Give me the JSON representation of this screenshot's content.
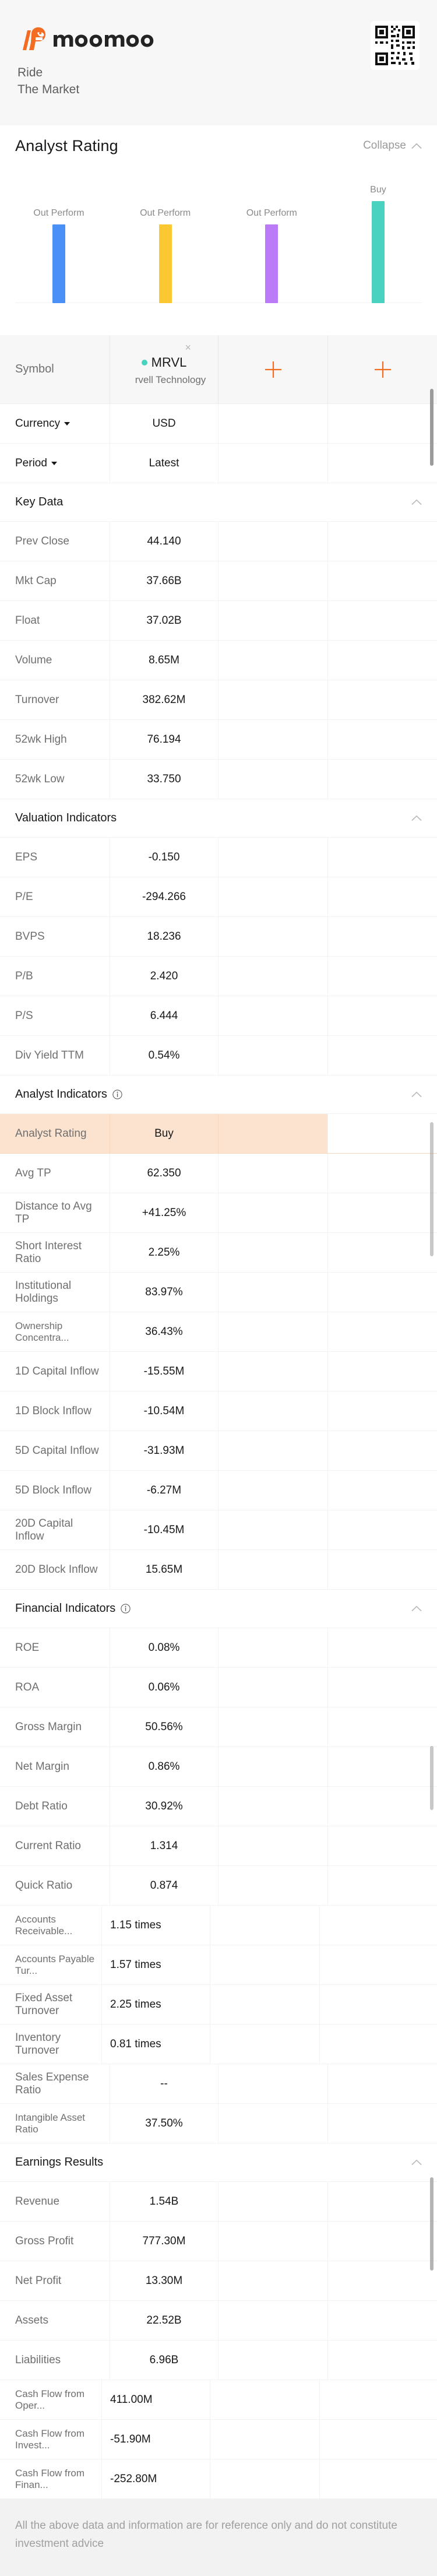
{
  "brand": {
    "name": "moomoo",
    "tagline_line1": "Ride",
    "tagline_line2": "The Market",
    "qr_alt": "qr-code"
  },
  "section": {
    "title": "Analyst Rating",
    "collapse_label": "Collapse"
  },
  "chart_data": {
    "type": "bar",
    "title": "Analyst Rating",
    "categories": [
      "Out Perform",
      "Out Perform",
      "Out Perform",
      "Buy"
    ],
    "values": [
      60,
      60,
      60,
      78
    ],
    "colors": [
      "#4a90f7",
      "#fbc833",
      "#bb7bf7",
      "#4ad2c0"
    ],
    "labels": [
      "Out Perform",
      "Out Perform",
      "Out Perform",
      "Buy"
    ],
    "xlabel": "",
    "ylabel": "",
    "ylim": [
      0,
      100
    ],
    "grid": false,
    "legend": "none"
  },
  "table": {
    "symbol_header_label": "Symbol",
    "columns": [
      {
        "ticker": "MRVL",
        "company": "rvell Technology",
        "dot_color": "#4ad2c0",
        "close_label": "×"
      },
      {
        "add_label": "+"
      },
      {
        "add_label": "+"
      }
    ],
    "controls": [
      {
        "label": "Currency",
        "value": "USD",
        "caret": true
      },
      {
        "label": "Period",
        "value": "Latest",
        "caret": true
      }
    ],
    "groups": [
      {
        "title": "Key Data",
        "info": false,
        "collapse_icon": "chevron-up-icon",
        "rows": [
          {
            "label": "Prev Close",
            "value": "44.140"
          },
          {
            "label": "Mkt Cap",
            "value": "37.66B"
          },
          {
            "label": "Float",
            "value": "37.02B"
          },
          {
            "label": "Volume",
            "value": "8.65M"
          },
          {
            "label": "Turnover",
            "value": "382.62M"
          },
          {
            "label": "52wk High",
            "value": "76.194"
          },
          {
            "label": "52wk Low",
            "value": "33.750"
          }
        ]
      },
      {
        "title": "Valuation Indicators",
        "info": false,
        "collapse_icon": "chevron-up-icon",
        "rows": [
          {
            "label": "EPS",
            "value": "-0.150"
          },
          {
            "label": "P/E",
            "value": "-294.266"
          },
          {
            "label": "BVPS",
            "value": "18.236"
          },
          {
            "label": "P/B",
            "value": "2.420"
          },
          {
            "label": "P/S",
            "value": "6.444"
          },
          {
            "label": "Div Yield TTM",
            "value": "0.54%"
          }
        ]
      },
      {
        "title": "Analyst Indicators",
        "info": true,
        "collapse_icon": "chevron-up-icon",
        "rows": [
          {
            "label": "Analyst Rating",
            "value": "Buy",
            "highlight": true
          },
          {
            "label": "Avg TP",
            "value": "62.350"
          },
          {
            "label": "Distance to Avg TP",
            "value": "+41.25%"
          },
          {
            "label": "Short Interest Ratio",
            "value": "2.25%"
          },
          {
            "label": "Institutional Holdings",
            "value": "83.97%"
          },
          {
            "label": "Ownership Concentra...",
            "value": "36.43%",
            "small": true
          },
          {
            "label": "1D Capital Inflow",
            "value": "-15.55M"
          },
          {
            "label": "1D Block Inflow",
            "value": "-10.54M"
          },
          {
            "label": "5D Capital Inflow",
            "value": "-31.93M"
          },
          {
            "label": "5D Block Inflow",
            "value": "-6.27M"
          },
          {
            "label": "20D Capital Inflow",
            "value": "-10.45M"
          },
          {
            "label": "20D Block Inflow",
            "value": "15.65M"
          }
        ]
      },
      {
        "title": "Financial Indicators",
        "info": true,
        "collapse_icon": "chevron-up-icon",
        "rows": [
          {
            "label": "ROE",
            "value": "0.08%"
          },
          {
            "label": "ROA",
            "value": "0.06%"
          },
          {
            "label": "Gross Margin",
            "value": "50.56%"
          },
          {
            "label": "Net Margin",
            "value": "0.86%"
          },
          {
            "label": "Debt Ratio",
            "value": "30.92%"
          },
          {
            "label": "Current Ratio",
            "value": "1.314"
          },
          {
            "label": "Quick Ratio",
            "value": "0.874"
          },
          {
            "label": "Accounts Receivable...",
            "value": "1.15 times",
            "small": true,
            "overflow": true
          },
          {
            "label": "Accounts Payable Tur...",
            "value": "1.57 times",
            "small": true,
            "overflow": true
          },
          {
            "label": "Fixed Asset Turnover",
            "value": "2.25 times",
            "overflow": true
          },
          {
            "label": "Inventory Turnover",
            "value": "0.81 times",
            "overflow": true
          },
          {
            "label": "Sales Expense Ratio",
            "value": "--"
          },
          {
            "label": "Intangible Asset Ratio",
            "value": "37.50%",
            "small": true
          }
        ]
      },
      {
        "title": "Earnings Results",
        "info": false,
        "collapse_icon": "chevron-up-icon",
        "rows": [
          {
            "label": "Revenue",
            "value": "1.54B"
          },
          {
            "label": "Gross Profit",
            "value": "777.30M"
          },
          {
            "label": "Net Profit",
            "value": "13.30M"
          },
          {
            "label": "Assets",
            "value": "22.52B"
          },
          {
            "label": "Liabilities",
            "value": "6.96B"
          },
          {
            "label": "Cash Flow from Oper...",
            "value": "411.00M",
            "small": true,
            "overflow": true
          },
          {
            "label": "Cash Flow from Invest...",
            "value": "-51.90M",
            "small": true,
            "overflow": true
          },
          {
            "label": "Cash Flow from Finan...",
            "value": "-252.80M",
            "small": true,
            "overflow": true
          }
        ]
      }
    ]
  },
  "footer": {
    "disclaimer": "All the above data and information are for reference only and do not constitute investment advice"
  },
  "colors": {
    "brand_orange": "#f36c21",
    "accent_teal": "#4ad2c0",
    "highlight_bg": "#fbe3cf"
  }
}
